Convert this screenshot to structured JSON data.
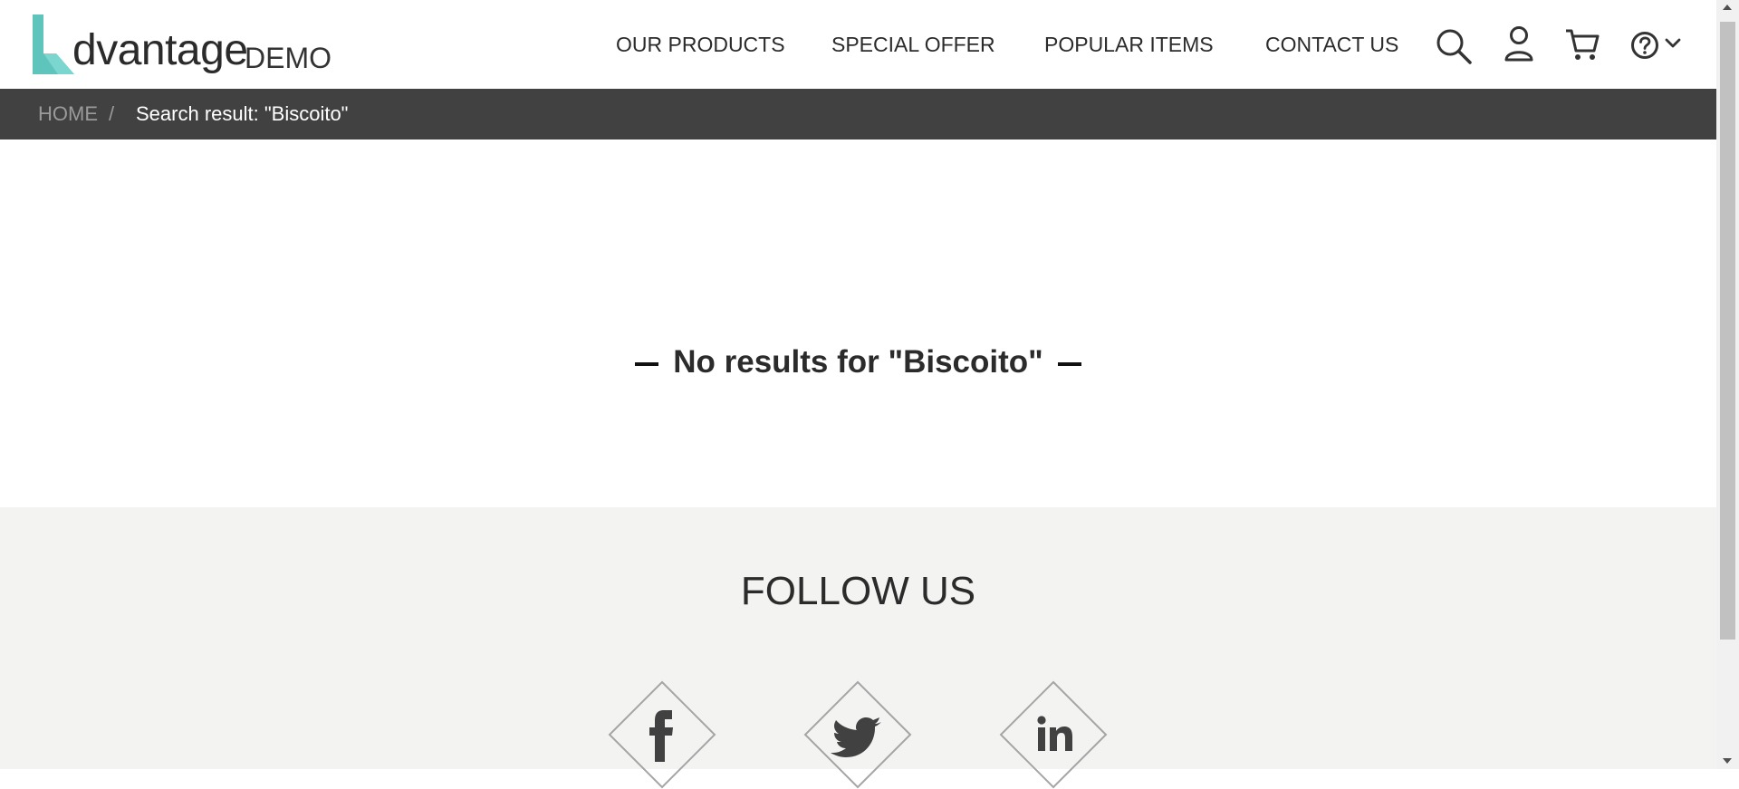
{
  "header": {
    "logo_text": "dvantage",
    "logo_demo": "DEMO",
    "nav": [
      "OUR PRODUCTS",
      "SPECIAL OFFER",
      "POPULAR ITEMS",
      "CONTACT US"
    ],
    "icons": [
      "search-icon",
      "user-icon",
      "cart-icon",
      "help-icon",
      "chevron-down-icon"
    ]
  },
  "breadcrumb": {
    "home": "HOME",
    "separator": "/",
    "current": "Search result: \"Biscoito\""
  },
  "main": {
    "message": "No results for \"Biscoito\""
  },
  "footer": {
    "title": "FOLLOW US",
    "social": [
      "facebook-icon",
      "twitter-icon",
      "linkedin-icon"
    ]
  },
  "colors": {
    "brand": "#5ec4bc",
    "breadcrumb_bg": "#414141",
    "footer_bg": "#f3f3f2"
  }
}
